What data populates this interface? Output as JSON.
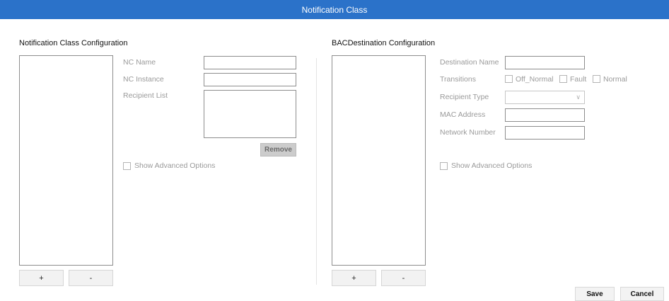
{
  "window": {
    "title": "Notification Class"
  },
  "left": {
    "section_title": "Notification Class Configuration",
    "nc_name_label": "NC Name",
    "nc_instance_label": "NC Instance",
    "recipient_list_label": "Recipient List",
    "remove_label": "Remove",
    "show_advanced_label": "Show Advanced Options",
    "add_label": "+",
    "remove_item_label": "-"
  },
  "right": {
    "section_title": "BACDestination Configuration",
    "destination_name_label": "Destination Name",
    "transitions_label": "Transitions",
    "transition_options": [
      "Off_Normal",
      "Fault",
      "Normal"
    ],
    "recipient_type_label": "Recipient Type",
    "mac_address_label": "MAC Address",
    "network_number_label": "Network Number",
    "show_advanced_label": "Show Advanced Options",
    "add_label": "+",
    "remove_item_label": "-"
  },
  "footer": {
    "save_label": "Save",
    "cancel_label": "Cancel"
  }
}
